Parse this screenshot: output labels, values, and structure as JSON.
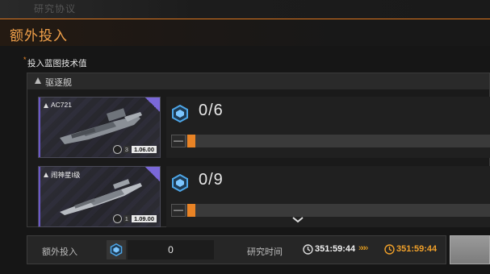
{
  "top_strip": {
    "background_title": "研究协议"
  },
  "header": {
    "title": "额外投入"
  },
  "section": {
    "required_mark": "*",
    "label": "投入蓝图技术值"
  },
  "ship_class": {
    "label": "驱逐舰",
    "icon": "destroyer-class-icon"
  },
  "ships": [
    {
      "name": "AC721",
      "owned_count": "3",
      "stat_value": "1.06.00",
      "quantity": "0/6"
    },
    {
      "name": "闹神星I级",
      "owned_count": "1",
      "stat_value": "1.09.00",
      "quantity": "0/9"
    }
  ],
  "footer": {
    "extra_input_label": "额外投入",
    "extra_input_value": "0",
    "research_time_label": "研究时间",
    "current_time": "351:59:44",
    "arrows": "»»»",
    "new_time": "351:59:44"
  },
  "colors": {
    "accent": "#e98325",
    "time_highlight": "#f0a02a",
    "card_border": "#6b58c8"
  }
}
